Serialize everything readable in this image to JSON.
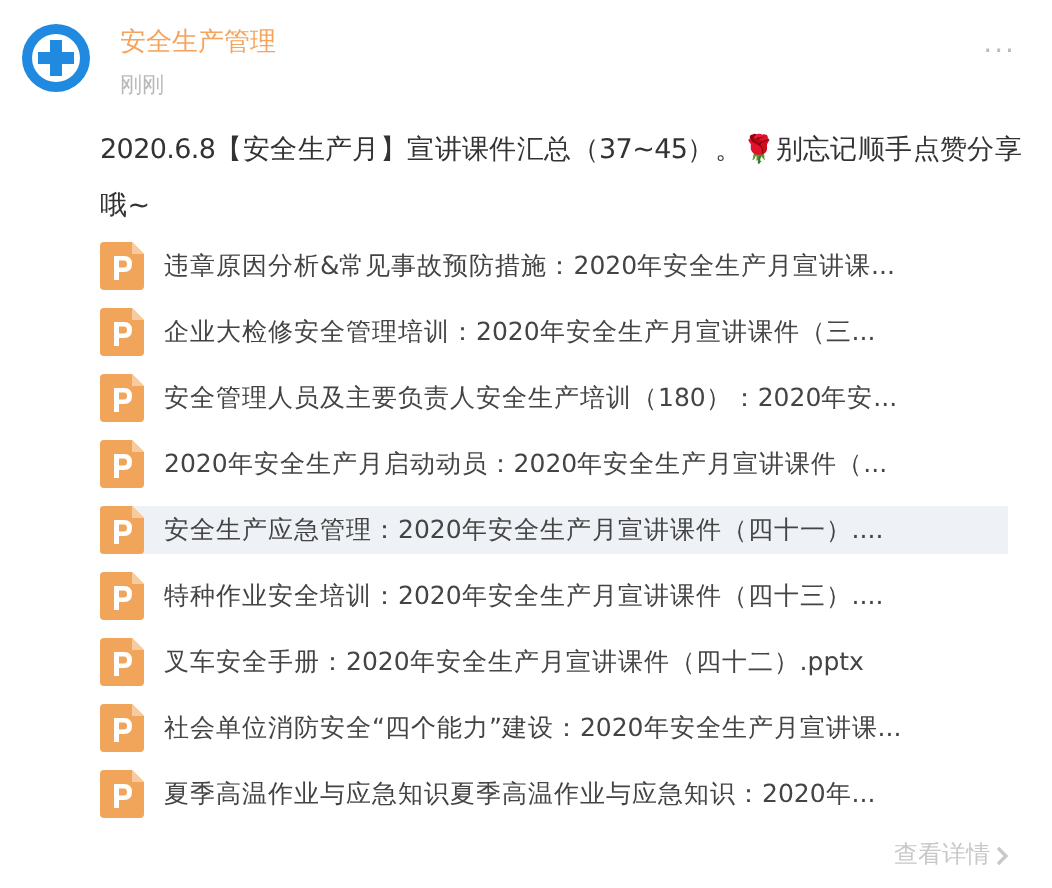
{
  "author": {
    "name": "安全生产管理",
    "time": "刚刚"
  },
  "more": "···",
  "post": {
    "text": "2020.6.8【安全生产月】宣讲课件汇总（37~45）。🌹别忘记顺手点赞分享哦~"
  },
  "files": [
    {
      "name": "违章原因分析&常见事故预防措施：2020年安全生产月宣讲课...",
      "hovered": false
    },
    {
      "name": "企业大检修安全管理培训：2020年安全生产月宣讲课件（三...",
      "hovered": false
    },
    {
      "name": "安全管理人员及主要负责人安全生产培训（180）：2020年安...",
      "hovered": false
    },
    {
      "name": "2020年安全生产月启动动员：2020年安全生产月宣讲课件（...",
      "hovered": false
    },
    {
      "name": "安全生产应急管理：2020年安全生产月宣讲课件（四十一）....",
      "hovered": true
    },
    {
      "name": "特种作业安全培训：2020年安全生产月宣讲课件（四十三）....",
      "hovered": false
    },
    {
      "name": "叉车安全手册：2020年安全生产月宣讲课件（四十二）.pptx",
      "hovered": false
    },
    {
      "name": "社会单位消防安全“四个能力”建设：2020年安全生产月宣讲课...",
      "hovered": false
    },
    {
      "name": "夏季高温作业与应急知识夏季高温作业与应急知识：2020年...",
      "hovered": false
    }
  ],
  "details_link": "查看详情"
}
